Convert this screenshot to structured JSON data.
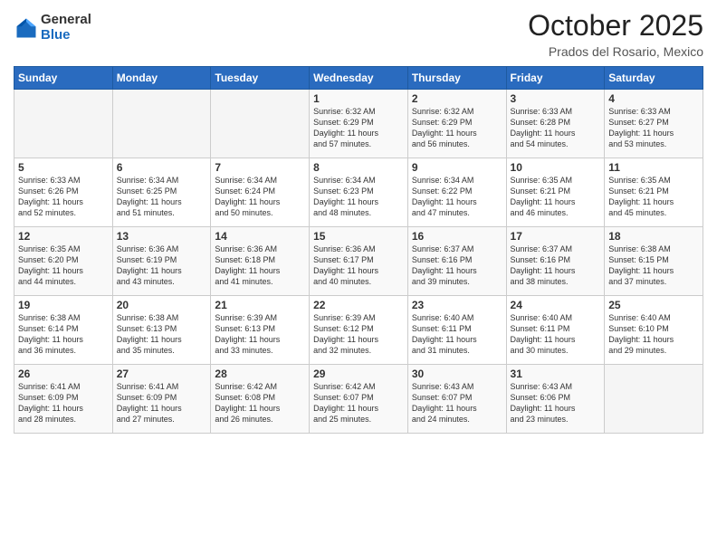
{
  "logo": {
    "general": "General",
    "blue": "Blue"
  },
  "header": {
    "month": "October 2025",
    "location": "Prados del Rosario, Mexico"
  },
  "weekdays": [
    "Sunday",
    "Monday",
    "Tuesday",
    "Wednesday",
    "Thursday",
    "Friday",
    "Saturday"
  ],
  "weeks": [
    [
      {
        "day": "",
        "info": ""
      },
      {
        "day": "",
        "info": ""
      },
      {
        "day": "",
        "info": ""
      },
      {
        "day": "1",
        "info": "Sunrise: 6:32 AM\nSunset: 6:29 PM\nDaylight: 11 hours\nand 57 minutes."
      },
      {
        "day": "2",
        "info": "Sunrise: 6:32 AM\nSunset: 6:29 PM\nDaylight: 11 hours\nand 56 minutes."
      },
      {
        "day": "3",
        "info": "Sunrise: 6:33 AM\nSunset: 6:28 PM\nDaylight: 11 hours\nand 54 minutes."
      },
      {
        "day": "4",
        "info": "Sunrise: 6:33 AM\nSunset: 6:27 PM\nDaylight: 11 hours\nand 53 minutes."
      }
    ],
    [
      {
        "day": "5",
        "info": "Sunrise: 6:33 AM\nSunset: 6:26 PM\nDaylight: 11 hours\nand 52 minutes."
      },
      {
        "day": "6",
        "info": "Sunrise: 6:34 AM\nSunset: 6:25 PM\nDaylight: 11 hours\nand 51 minutes."
      },
      {
        "day": "7",
        "info": "Sunrise: 6:34 AM\nSunset: 6:24 PM\nDaylight: 11 hours\nand 50 minutes."
      },
      {
        "day": "8",
        "info": "Sunrise: 6:34 AM\nSunset: 6:23 PM\nDaylight: 11 hours\nand 48 minutes."
      },
      {
        "day": "9",
        "info": "Sunrise: 6:34 AM\nSunset: 6:22 PM\nDaylight: 11 hours\nand 47 minutes."
      },
      {
        "day": "10",
        "info": "Sunrise: 6:35 AM\nSunset: 6:21 PM\nDaylight: 11 hours\nand 46 minutes."
      },
      {
        "day": "11",
        "info": "Sunrise: 6:35 AM\nSunset: 6:21 PM\nDaylight: 11 hours\nand 45 minutes."
      }
    ],
    [
      {
        "day": "12",
        "info": "Sunrise: 6:35 AM\nSunset: 6:20 PM\nDaylight: 11 hours\nand 44 minutes."
      },
      {
        "day": "13",
        "info": "Sunrise: 6:36 AM\nSunset: 6:19 PM\nDaylight: 11 hours\nand 43 minutes."
      },
      {
        "day": "14",
        "info": "Sunrise: 6:36 AM\nSunset: 6:18 PM\nDaylight: 11 hours\nand 41 minutes."
      },
      {
        "day": "15",
        "info": "Sunrise: 6:36 AM\nSunset: 6:17 PM\nDaylight: 11 hours\nand 40 minutes."
      },
      {
        "day": "16",
        "info": "Sunrise: 6:37 AM\nSunset: 6:16 PM\nDaylight: 11 hours\nand 39 minutes."
      },
      {
        "day": "17",
        "info": "Sunrise: 6:37 AM\nSunset: 6:16 PM\nDaylight: 11 hours\nand 38 minutes."
      },
      {
        "day": "18",
        "info": "Sunrise: 6:38 AM\nSunset: 6:15 PM\nDaylight: 11 hours\nand 37 minutes."
      }
    ],
    [
      {
        "day": "19",
        "info": "Sunrise: 6:38 AM\nSunset: 6:14 PM\nDaylight: 11 hours\nand 36 minutes."
      },
      {
        "day": "20",
        "info": "Sunrise: 6:38 AM\nSunset: 6:13 PM\nDaylight: 11 hours\nand 35 minutes."
      },
      {
        "day": "21",
        "info": "Sunrise: 6:39 AM\nSunset: 6:13 PM\nDaylight: 11 hours\nand 33 minutes."
      },
      {
        "day": "22",
        "info": "Sunrise: 6:39 AM\nSunset: 6:12 PM\nDaylight: 11 hours\nand 32 minutes."
      },
      {
        "day": "23",
        "info": "Sunrise: 6:40 AM\nSunset: 6:11 PM\nDaylight: 11 hours\nand 31 minutes."
      },
      {
        "day": "24",
        "info": "Sunrise: 6:40 AM\nSunset: 6:11 PM\nDaylight: 11 hours\nand 30 minutes."
      },
      {
        "day": "25",
        "info": "Sunrise: 6:40 AM\nSunset: 6:10 PM\nDaylight: 11 hours\nand 29 minutes."
      }
    ],
    [
      {
        "day": "26",
        "info": "Sunrise: 6:41 AM\nSunset: 6:09 PM\nDaylight: 11 hours\nand 28 minutes."
      },
      {
        "day": "27",
        "info": "Sunrise: 6:41 AM\nSunset: 6:09 PM\nDaylight: 11 hours\nand 27 minutes."
      },
      {
        "day": "28",
        "info": "Sunrise: 6:42 AM\nSunset: 6:08 PM\nDaylight: 11 hours\nand 26 minutes."
      },
      {
        "day": "29",
        "info": "Sunrise: 6:42 AM\nSunset: 6:07 PM\nDaylight: 11 hours\nand 25 minutes."
      },
      {
        "day": "30",
        "info": "Sunrise: 6:43 AM\nSunset: 6:07 PM\nDaylight: 11 hours\nand 24 minutes."
      },
      {
        "day": "31",
        "info": "Sunrise: 6:43 AM\nSunset: 6:06 PM\nDaylight: 11 hours\nand 23 minutes."
      },
      {
        "day": "",
        "info": ""
      }
    ]
  ]
}
